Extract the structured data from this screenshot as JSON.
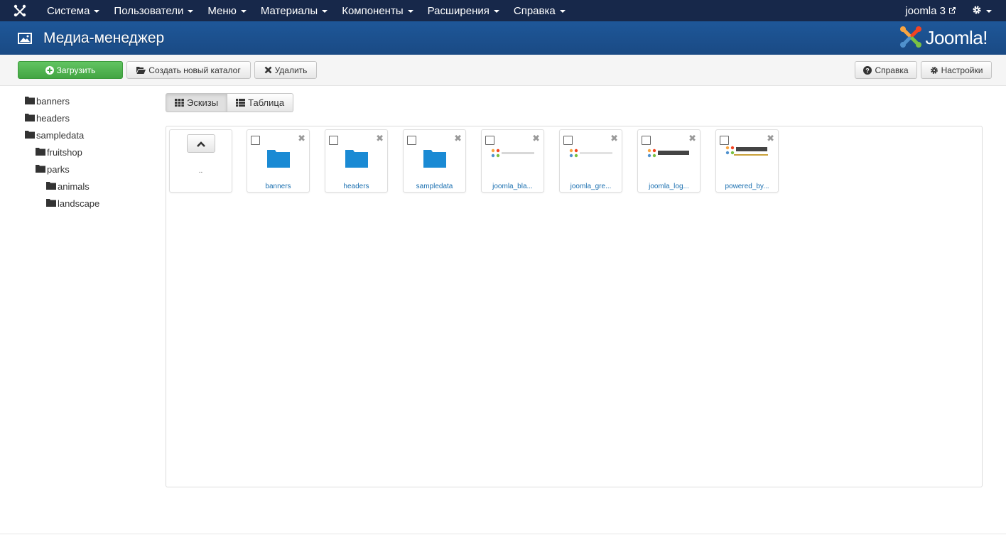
{
  "navbar": {
    "menu": [
      {
        "label": "Система"
      },
      {
        "label": "Пользователи"
      },
      {
        "label": "Меню"
      },
      {
        "label": "Материалы"
      },
      {
        "label": "Компоненты"
      },
      {
        "label": "Расширения"
      },
      {
        "label": "Справка"
      }
    ],
    "user_label": "joomla 3"
  },
  "header": {
    "title": "Медиа-менеджер",
    "brand": "Joomla!"
  },
  "toolbar": {
    "upload_label": "Загрузить",
    "new_folder_label": "Создать новый каталог",
    "delete_label": "Удалить",
    "help_label": "Справка",
    "options_label": "Настройки"
  },
  "tree": [
    {
      "label": "banners"
    },
    {
      "label": "headers"
    },
    {
      "label": "sampledata"
    },
    {
      "label": "fruitshop"
    },
    {
      "label": "parks"
    },
    {
      "label": "animals"
    },
    {
      "label": "landscape"
    }
  ],
  "view_tabs": {
    "thumbnails_label": "Эскизы",
    "table_label": "Таблица"
  },
  "media": {
    "up_label": "..",
    "items": [
      {
        "label": "banners"
      },
      {
        "label": "headers"
      },
      {
        "label": "sampledata"
      },
      {
        "label": "joomla_bla..."
      },
      {
        "label": "joomla_gre..."
      },
      {
        "label": "joomla_log..."
      },
      {
        "label": "powered_by..."
      }
    ]
  },
  "colors": {
    "navbar": "#17284a",
    "header": "#1e5799",
    "upload_button": "#52b452",
    "folder": "#1a8ad4",
    "link": "#1a6fb0"
  }
}
